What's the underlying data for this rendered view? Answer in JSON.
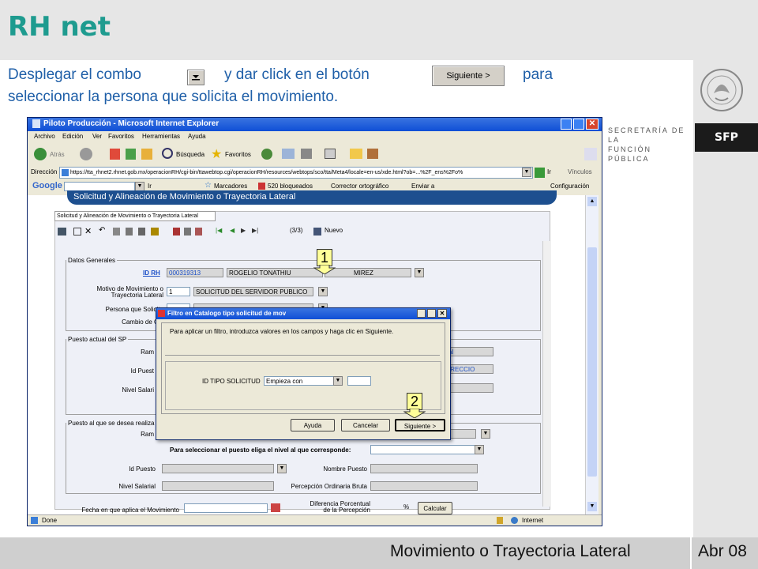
{
  "header": {
    "title": "RH net"
  },
  "instructions": {
    "part1": "Desplegar el combo",
    "part2": "y dar click en el botón",
    "part3": "para",
    "line2": "seleccionar la persona que solicita el movimiento.",
    "siguiente_btn": "Siguiente >"
  },
  "branding": {
    "org_line1": "SECRETARÍA DE LA",
    "org_line2": "FUNCIÓN PÚBLICA",
    "org_short": "SFP"
  },
  "footer": {
    "title": "Movimiento o Trayectoria Lateral",
    "date": "Abr 08"
  },
  "browser": {
    "window_title": "Piloto Producción - Microsoft Internet Explorer",
    "menu": [
      "Archivo",
      "Edición",
      "Ver",
      "Favoritos",
      "Herramientas",
      "Ayuda"
    ],
    "toolbar": {
      "back": "Atrás",
      "search": "Búsqueda",
      "favorites": "Favoritos"
    },
    "address_label": "Dirección",
    "address": "https://tta_rhnet2.rhnet.gob.mx/operacionRH/cgi-bin/ttawebtop.cgi/operacionRH/resources/webtops/sco/tta/Meta4/locale=en-us/xde.html?ob=...%2F_ens%2Fo%",
    "go": "Ir",
    "links": "Vínculos",
    "google_toolbar": {
      "go": "Ir",
      "bookmarks": "Marcadores",
      "blocked": "520 bloqueados",
      "spell": "Corrector ortográfico",
      "send": "Enviar a",
      "settings": "Configuración"
    },
    "status": "Done",
    "zone": "Internet"
  },
  "app": {
    "banner": "Solicitud y Alineación de Movimiento o Trayectoria Lateral",
    "tab": "Solicitud y Alineación de Movimiento o Trayectoria Lateral",
    "record_count": "(3/3)",
    "nuevo": "Nuevo",
    "datos_generales": "Datos Generales",
    "id_rh_label": "ID RH",
    "id_rh_value": "000319313",
    "name_value": "ROGELIO TONATHIU",
    "surname_value": "MIREZ",
    "motivo_label_1": "Motivo  de Movimiento o",
    "motivo_label_2": "Trayectoria Lateral",
    "motivo_code": "1",
    "motivo_value": "SOLICITUD DEL SERVIDOR PUBLICO",
    "persona_label": "Persona que Solicita",
    "cambio_label": "Cambio de Ciu",
    "puesto_actual": "Puesto actual del SP",
    "ram_label": "Ram",
    "id_puesto_label_short": "Id Puest",
    "nivel_label_short": "Nivel Salari",
    "partial_1": "al",
    "partial_2": "IRECCIO",
    "puesto_destino": "Puesto al que se desea realiza",
    "ram2_label": "Ram",
    "nivel_prompt": "Para seleccionar el puesto eliga el nivel al que corresponde:",
    "id_puesto_label": "Id Puesto",
    "nombre_puesto_label": "Nombre Puesto",
    "nivel_salarial_label": "Nivel Salarial",
    "percepcion_label": "Percepción Ordinaria Bruta",
    "fecha_label": "Fecha en que aplica el Movimiento",
    "diferencia_label_1": "Diferencia Porcentual",
    "diferencia_label_2": "de la Percepción",
    "percent": "%",
    "calcular": "Calcular"
  },
  "dialog": {
    "title": "Filtro en Catalogo tipo solicitud de mov",
    "message": "Para aplicar un filtro, introduzca valores en los campos y haga clic en Siguiente.",
    "field_label": "ID TIPO SOLICITUD",
    "operator": "Empieza con",
    "value": "",
    "buttons": {
      "help": "Ayuda",
      "cancel": "Cancelar",
      "next": "Siguiente >"
    }
  },
  "callouts": {
    "one": "1",
    "two": "2"
  },
  "colors": {
    "title": "#1e9b8f",
    "instructions": "#1f5fa8",
    "banner": "#1d4f8f"
  }
}
